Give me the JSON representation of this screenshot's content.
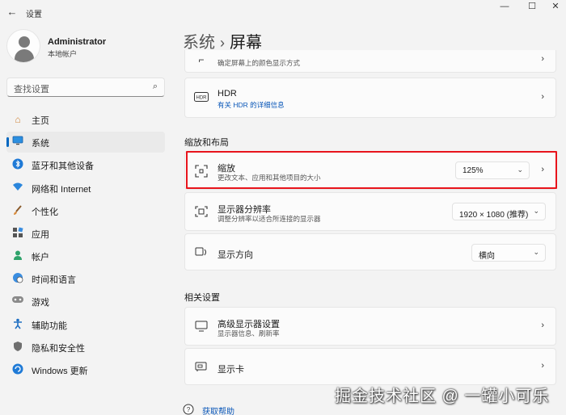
{
  "window": {
    "title": "设置",
    "back_icon": "back-arrow-icon",
    "minimize": "—",
    "maximize": "☐",
    "close": "✕"
  },
  "profile": {
    "name": "Administrator",
    "account_type": "本地帐户"
  },
  "search": {
    "placeholder": "查找设置"
  },
  "sidebar": {
    "items": [
      {
        "label": "主页",
        "icon": "home-icon"
      },
      {
        "label": "系统",
        "icon": "monitor-icon",
        "selected": true
      },
      {
        "label": "蓝牙和其他设备",
        "icon": "bluetooth-icon"
      },
      {
        "label": "网络和 Internet",
        "icon": "wifi-icon"
      },
      {
        "label": "个性化",
        "icon": "brush-icon"
      },
      {
        "label": "应用",
        "icon": "apps-icon"
      },
      {
        "label": "帐户",
        "icon": "person-icon"
      },
      {
        "label": "时间和语言",
        "icon": "globe-clock-icon"
      },
      {
        "label": "游戏",
        "icon": "gamepad-icon"
      },
      {
        "label": "辅助功能",
        "icon": "accessibility-icon"
      },
      {
        "label": "隐私和安全性",
        "icon": "shield-icon"
      },
      {
        "label": "Windows 更新",
        "icon": "update-icon"
      }
    ]
  },
  "breadcrumb": {
    "parent": "系统",
    "separator": "›",
    "current": "屏幕"
  },
  "cards": {
    "color_profile": {
      "subtitle": "确定屏幕上的颜色显示方式"
    },
    "hdr": {
      "title": "HDR",
      "link": "有关 HDR 的详细信息"
    }
  },
  "section_scale": {
    "title": "缩放和布局",
    "scale": {
      "title": "缩放",
      "subtitle": "更改文本、应用和其他项目的大小",
      "value": "125%"
    },
    "resolution": {
      "title": "显示器分辨率",
      "subtitle": "调整分辨率以适合所连接的显示器",
      "value": "1920 × 1080 (推荐)"
    },
    "orientation": {
      "title": "显示方向",
      "value": "横向"
    }
  },
  "section_related": {
    "title": "相关设置",
    "advanced": {
      "title": "高级显示器设置",
      "subtitle": "显示器信息、刷新率"
    },
    "graphics": {
      "title": "显示卡"
    }
  },
  "help": {
    "label": "获取帮助"
  },
  "watermark": "掘金技术社区 @ 一罐小可乐",
  "colors": {
    "accent": "#0067c0",
    "highlight_border": "#e8141c",
    "link": "#0a57b8"
  }
}
